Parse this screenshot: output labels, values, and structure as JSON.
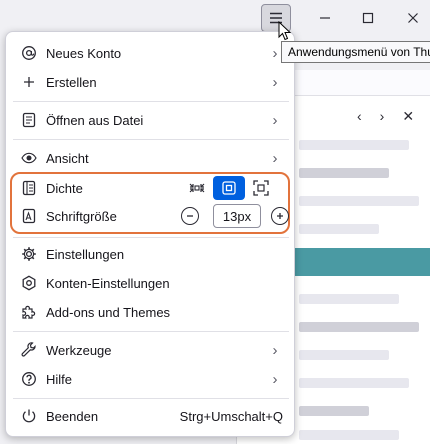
{
  "tooltip": "Anwendungsmenü von Thu",
  "menu": {
    "new_account": "Neues Konto",
    "create": "Erstellen",
    "open_file": "Öffnen aus Datei",
    "view": "Ansicht",
    "density": "Dichte",
    "font_size": "Schriftgröße",
    "font_size_value": "13px",
    "settings": "Einstellungen",
    "account_settings": "Konten-Einstellungen",
    "addons": "Add-ons und Themes",
    "tools": "Werkzeuge",
    "help": "Hilfe",
    "quit": "Beenden",
    "quit_shortcut": "Strg+Umschalt+Q"
  },
  "density": {
    "options": [
      "compact",
      "normal",
      "relaxed"
    ],
    "selected": "normal"
  },
  "colors": {
    "accent": "#0060df",
    "highlight": "#e2733c",
    "teal": "#4a9aa3"
  },
  "icons": {
    "hamburger": "hamburger-icon",
    "minimize": "minimize-icon",
    "maximize": "maximize-icon",
    "close": "close-icon"
  }
}
